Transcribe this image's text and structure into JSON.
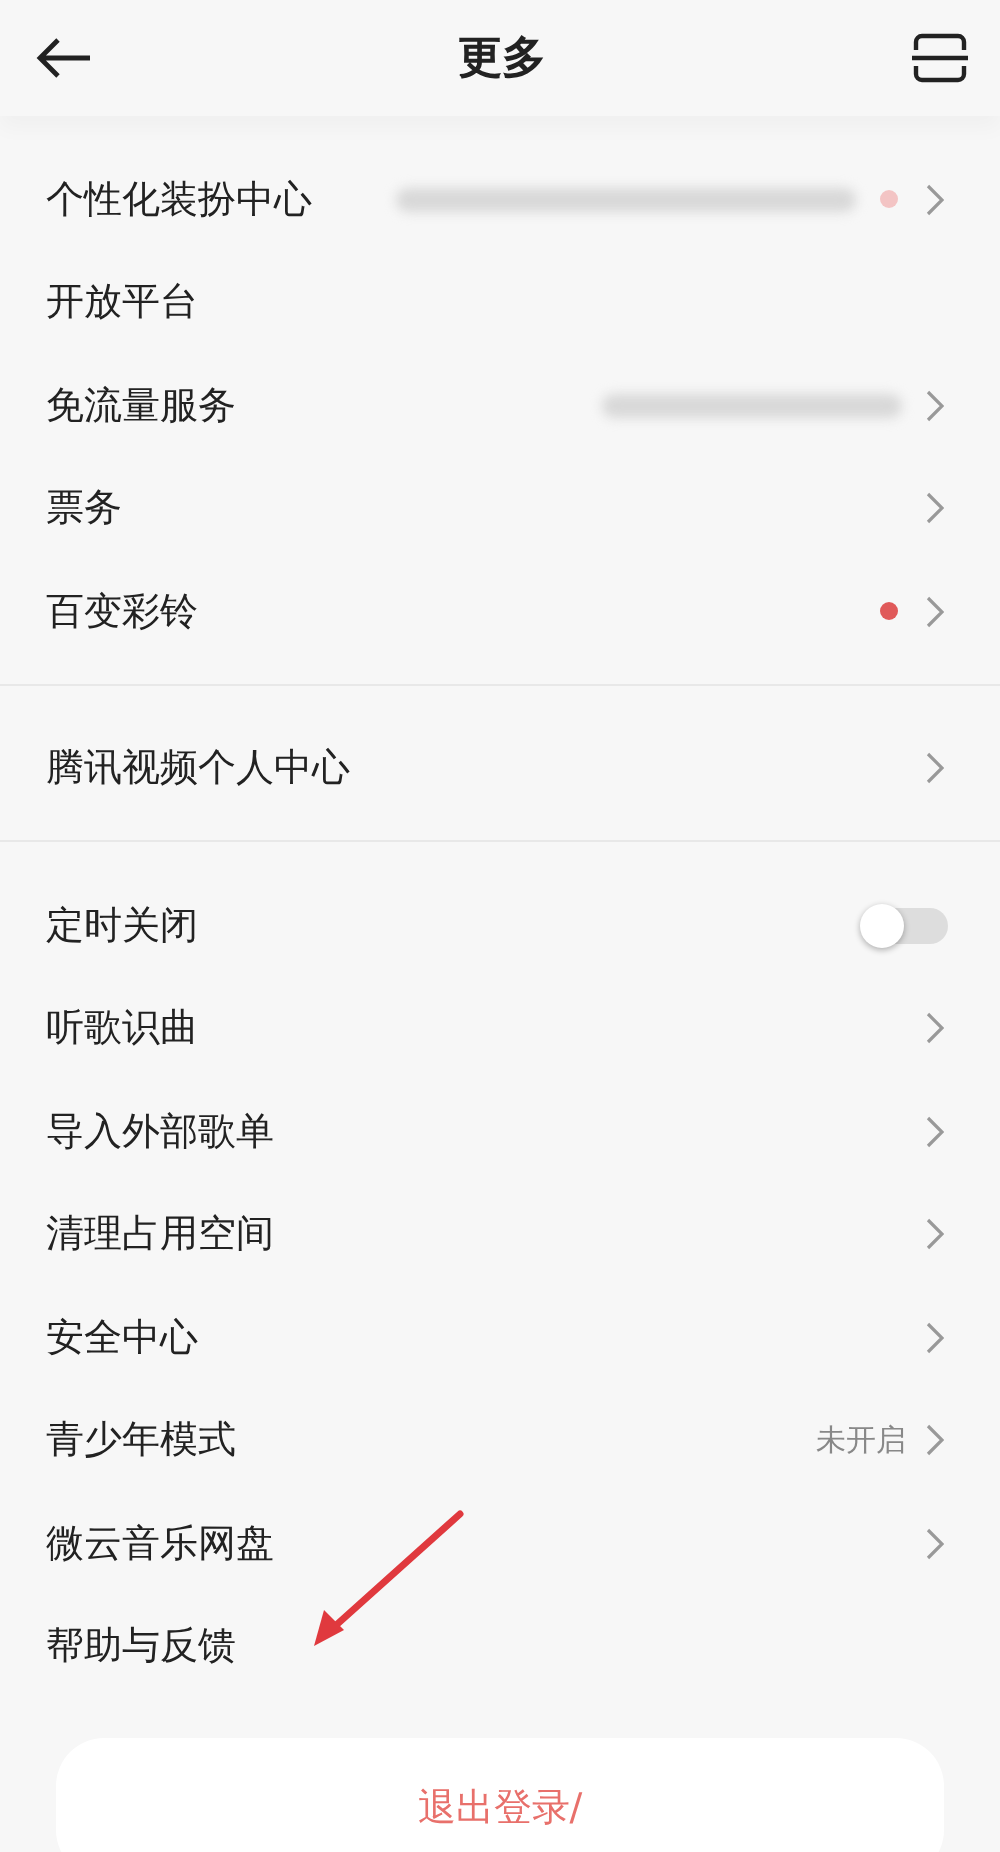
{
  "header": {
    "title": "更多"
  },
  "sections": [
    {
      "items": [
        {
          "label": "个性化装扮中心",
          "kind": "link",
          "hidden_value": true,
          "badge": true
        },
        {
          "label": "开放平台",
          "kind": "plain"
        },
        {
          "label": "免流量服务",
          "kind": "link",
          "hidden_value": true
        },
        {
          "label": "票务",
          "kind": "link"
        },
        {
          "label": "百变彩铃",
          "kind": "link",
          "badge": true
        }
      ]
    },
    {
      "items": [
        {
          "label": "腾讯视频个人中心",
          "kind": "link"
        }
      ]
    },
    {
      "items": [
        {
          "label": "定时关闭",
          "kind": "toggle",
          "on": false
        },
        {
          "label": "听歌识曲",
          "kind": "link"
        },
        {
          "label": "导入外部歌单",
          "kind": "link"
        },
        {
          "label": "清理占用空间",
          "kind": "link"
        },
        {
          "label": "安全中心",
          "kind": "link"
        },
        {
          "label": "青少年模式",
          "kind": "link",
          "value": "未开启"
        },
        {
          "label": "微云音乐网盘",
          "kind": "link"
        },
        {
          "label": "帮助与反馈",
          "kind": "plain"
        }
      ]
    }
  ],
  "logout_button": "退出登录/"
}
